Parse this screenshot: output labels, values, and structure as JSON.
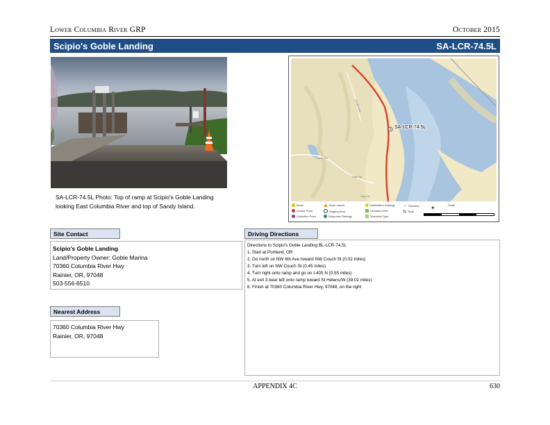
{
  "header": {
    "left": "Lower Columbia River GRP",
    "right": "October 2015"
  },
  "title": {
    "name": "Scipio's Goble Landing",
    "code": "SA-LCR-74.5L"
  },
  "photo": {
    "caption_line1": "SA-LCR-74.5L Photo: Top of ramp at Scipio's Goble Landing",
    "caption_line2": "looking East Columbia River and top of Sandy Island."
  },
  "map": {
    "site_label": "SA-LCR-74.5L",
    "road_labels": [
      "Crown Ave",
      "Goble Rd",
      "Dike Rd",
      "Hwy 30"
    ],
    "legend": [
      {
        "label": "Boom",
        "icon": "boom-icon",
        "color": "#d9c93a"
      },
      {
        "label": "Anchor Point",
        "icon": "anchor-point-icon",
        "color": "#c0392b"
      },
      {
        "label": "Staging Area",
        "icon": "staging-area-icon",
        "color": "#333333"
      },
      {
        "label": "Boat Launch",
        "icon": "boat-launch-icon",
        "color": "#e0a21a"
      },
      {
        "label": "Collection Point",
        "icon": "collection-point-icon",
        "color": "#7d3c98"
      },
      {
        "label": "Response Strategy",
        "icon": "response-strategy-icon",
        "color": "#2e8b57"
      },
      {
        "label": "Notification Strategy",
        "icon": "notification-strategy-icon",
        "color": "#cfcf2a"
      },
      {
        "label": "Sensitive Area",
        "icon": "sensitive-area-icon",
        "color": "#7fbf3f"
      },
      {
        "label": "Shoreline Type",
        "icon": "shoreline-type-icon",
        "color": "#9fd36b"
      },
      {
        "label": "Direction",
        "icon": "direction-icon",
        "color": "#555555"
      },
      {
        "label": "Tidal",
        "icon": "tidal-icon",
        "color": "#555555"
      },
      {
        "label": "Scale",
        "icon": "scale-icon",
        "color": "#000000"
      }
    ],
    "colors": {
      "land": "#f1e8c6",
      "water": "#a9c4df",
      "road": "#d9452b",
      "bar": "#bfd6ea"
    }
  },
  "site_contact": {
    "heading": "Site Contact",
    "name": "Scipio's Goble Landing",
    "owner": "Land/Property Owner: Goble Marina",
    "address1": "70360 Columbia River Hwy",
    "address2": "Rainier, OR, 97048",
    "phone": "503-556-6510"
  },
  "nearest_address": {
    "heading": "Nearest Address",
    "line1": "70360 Columbia River Hwy",
    "line2": "Rainier, OR, 97048"
  },
  "driving_directions": {
    "heading": "Driving Directions",
    "title": "Directions to Scipio's Goble Landing BL-LCR-74.5L",
    "steps": [
      "1. Start at Portland, OR",
      "2. Go north on NW 6th Ave toward NW Couch St (0.02 miles)",
      "3. Turn left on NW Couch St (0.45 miles)",
      "4. Turn right onto ramp and go on I-405 N (0.55 miles)",
      "5. At exit 3 bear left onto ramp toward St Helens/W (39.02 miles)",
      "6. Finish at 70360 Columbia River Hwy, 97048, on the right"
    ]
  },
  "footer": {
    "center": "APPENDIX 4C",
    "page": "630"
  }
}
